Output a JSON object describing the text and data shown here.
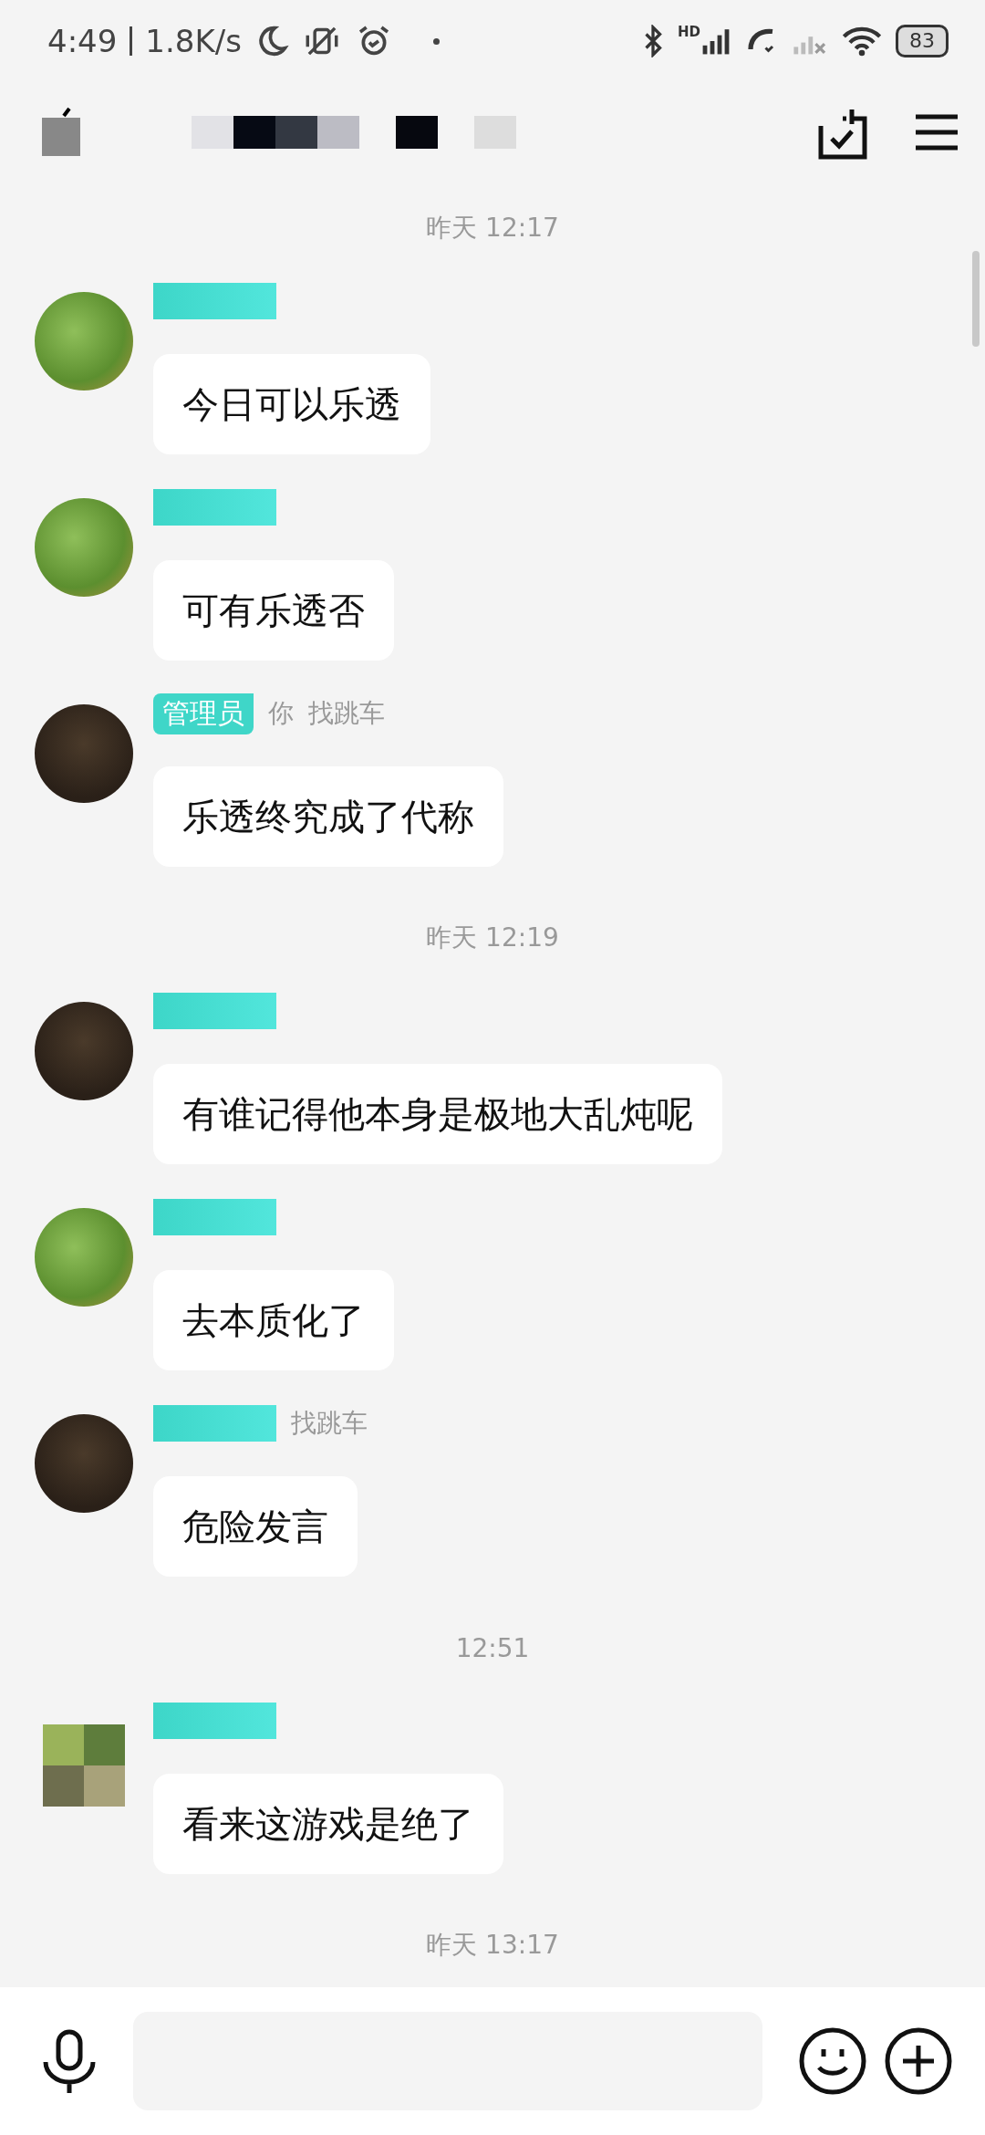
{
  "status_bar": {
    "time": "4:49",
    "speed": "1.8K/s",
    "network_label": "HD",
    "battery": "83"
  },
  "header": {
    "title_hidden": true
  },
  "chat": [
    {
      "kind": "time",
      "text": "昨天 12:17"
    },
    {
      "kind": "message",
      "avatar": {
        "kind": "grass"
      },
      "name": {
        "hidden": true
      },
      "text": "今日可以乐透"
    },
    {
      "kind": "message",
      "avatar": {
        "kind": "grass"
      },
      "name": {
        "hidden": true
      },
      "text": "可有乐透否"
    },
    {
      "kind": "message",
      "avatar": {
        "kind": "dark"
      },
      "name": {
        "hidden": false,
        "badge": "管理员",
        "fragments": [
          "你",
          "找跳车"
        ]
      },
      "text": "乐透终究成了代称"
    },
    {
      "kind": "time",
      "text": "昨天 12:19"
    },
    {
      "kind": "message",
      "avatar": {
        "kind": "dark"
      },
      "name": {
        "hidden": true
      },
      "text": "有谁记得他本身是极地大乱炖呢"
    },
    {
      "kind": "message",
      "avatar": {
        "kind": "grass"
      },
      "name": {
        "hidden": true
      },
      "text": "去本质化了"
    },
    {
      "kind": "message",
      "avatar": {
        "kind": "dark"
      },
      "name": {
        "hidden": true,
        "fragments": [
          "找跳车"
        ]
      },
      "text": "危险发言"
    },
    {
      "kind": "time",
      "text": "12:51"
    },
    {
      "kind": "message",
      "avatar": {
        "kind": "mosaic"
      },
      "name": {
        "hidden": true
      },
      "text": "看来这游戏是绝了"
    },
    {
      "kind": "time",
      "text": "昨天 13:17"
    }
  ]
}
